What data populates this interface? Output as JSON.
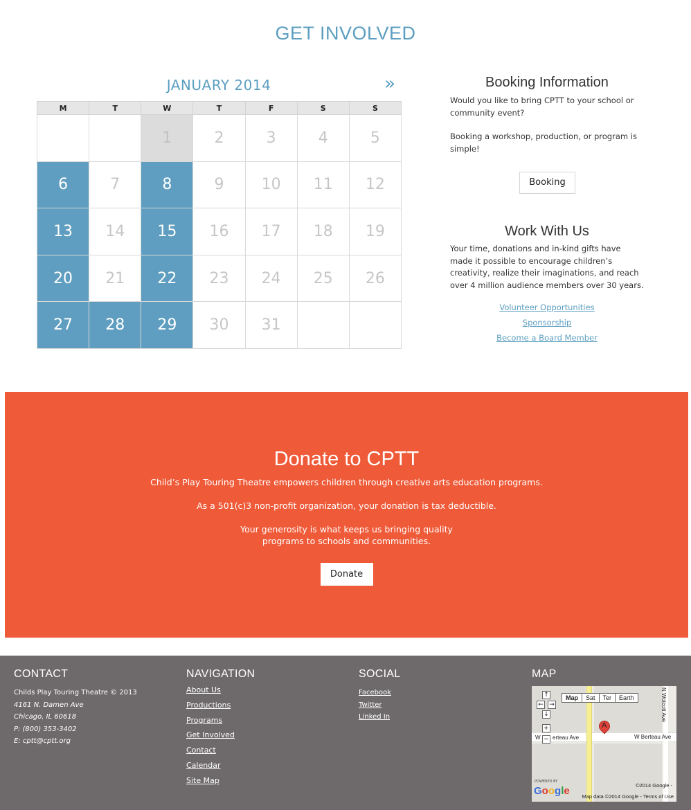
{
  "page_title": "GET INVOLVED",
  "calendar": {
    "month_label": "JANUARY  2014",
    "next_label": "»",
    "weekdays": [
      "M",
      "T",
      "W",
      "T",
      "F",
      "S",
      "S"
    ],
    "weeks": [
      [
        "",
        "",
        "1",
        "2",
        "3",
        "4",
        "5"
      ],
      [
        "6",
        "7",
        "8",
        "9",
        "10",
        "11",
        "12"
      ],
      [
        "13",
        "14",
        "15",
        "16",
        "17",
        "18",
        "19"
      ],
      [
        "20",
        "21",
        "22",
        "23",
        "24",
        "25",
        "26"
      ],
      [
        "27",
        "28",
        "29",
        "30",
        "31",
        "",
        ""
      ]
    ],
    "highlighted_days": [
      "6",
      "8",
      "13",
      "15",
      "20",
      "22",
      "27",
      "28",
      "29"
    ],
    "today": "1",
    "colors": {
      "highlight": "#5f9ec0",
      "today": "#dcdcdc"
    }
  },
  "booking": {
    "title": "Booking Information",
    "text1": "Would you like to bring CPTT to your school or community event?",
    "text2": "Booking a workshop, production, or program is simple!",
    "button_label": "Booking"
  },
  "work_with_us": {
    "title": "Work With Us",
    "text": "Your time, donations and in-kind gifts have made it possible to encourage children’s creativity, realize their imaginations, and reach over 4 million audience members over 30 years.",
    "links": [
      "Volunteer Opportunities",
      "Sponsorship",
      "Become a Board Member"
    ]
  },
  "donate": {
    "title": "Donate to CPTT",
    "line1": "Child’s Play Touring Theatre empowers children through creative arts education programs.",
    "line2": "As a 501(c)3 non-profit organization, your donation is tax deductible.",
    "line3a": "Your generosity is what keeps us bringing quality",
    "line3b": "programs to schools and communities.",
    "button_label": "Donate",
    "background_color": "#ef5a38"
  },
  "footer": {
    "contact": {
      "heading": "CONTACT",
      "org": "Childs Play Touring Theatre © 2013",
      "address1": "4161 N. Damen Ave",
      "address2": "Chicago, IL 60618",
      "phone": "P: (800) 353-3402",
      "email": "E: cptt@cptt.org"
    },
    "navigation": {
      "heading": "NAVIGATION",
      "links": [
        "About Us",
        "Productions",
        "Programs",
        "Get Involved",
        "Contact",
        "Calendar",
        "Site Map"
      ]
    },
    "social": {
      "heading": "SOCIAL",
      "links": [
        "Facebook",
        "Twitter",
        "Linked In"
      ]
    },
    "map": {
      "heading": "MAP",
      "types": [
        "Map",
        "Sat",
        "Ter",
        "Earth"
      ],
      "street_label": "W Berteau Ave",
      "street_label_left": "W",
      "street_label_mid": "erteau Ave",
      "side_street": "N Wolcott Ave",
      "marker": "A",
      "copyright": "©2014 Google -",
      "attribution": "Map data ©2014 Google - Terms of Use",
      "powered": "POWERED BY",
      "logo": "Google"
    },
    "background_color": "#6e6a6b"
  }
}
